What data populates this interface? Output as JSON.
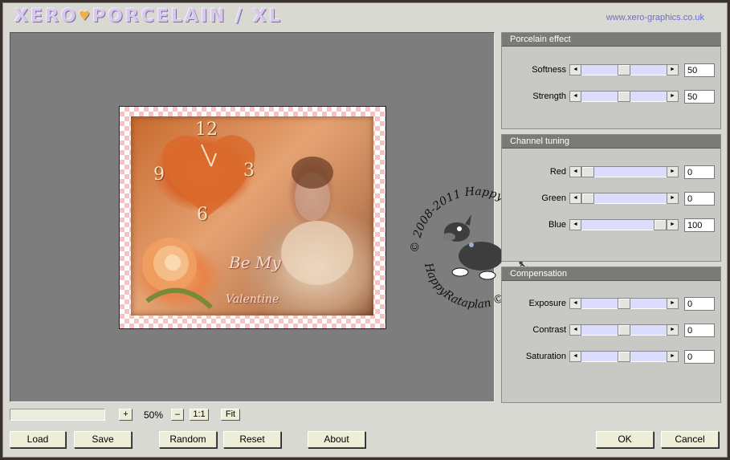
{
  "app": {
    "logo_text": "XERO",
    "logo_heart": "♥",
    "logo_text2": "PORCELAIN / XL",
    "site_url": "www.xero-graphics.co.uk"
  },
  "preview": {
    "clock_numbers": [
      "12",
      "3",
      "6",
      "9"
    ],
    "text_be_my": "Be My",
    "text_valentine": "Valentine",
    "watermark_top": "© 2008-2011 HappyRataplan",
    "watermark_bottom": "HappyRataplan © 2008-2011"
  },
  "porcelain": {
    "header": "Porcelain effect",
    "softness": {
      "label": "Softness",
      "value": "50",
      "position": 0.5
    },
    "strength": {
      "label": "Strength",
      "value": "50",
      "position": 0.5
    }
  },
  "channel": {
    "header": "Channel tuning",
    "red": {
      "label": "Red",
      "value": "0",
      "position": 0.0
    },
    "green": {
      "label": "Green",
      "value": "0",
      "position": 0.0
    },
    "blue": {
      "label": "Blue",
      "value": "100",
      "position": 1.0
    }
  },
  "compensation": {
    "header": "Compensation",
    "exposure": {
      "label": "Exposure",
      "value": "0",
      "position": 0.5
    },
    "contrast": {
      "label": "Contrast",
      "value": "0",
      "position": 0.5
    },
    "saturation": {
      "label": "Saturation",
      "value": "0",
      "position": 0.5
    }
  },
  "zoom": {
    "plus": "+",
    "minus": "–",
    "value": "50%",
    "one_to_one": "1:1",
    "fit": "Fit"
  },
  "buttons": {
    "load": "Load",
    "save": "Save",
    "random": "Random",
    "reset": "Reset",
    "about": "About",
    "ok": "OK",
    "cancel": "Cancel"
  },
  "icons": {
    "slider_left": "◄",
    "slider_right": "►"
  }
}
